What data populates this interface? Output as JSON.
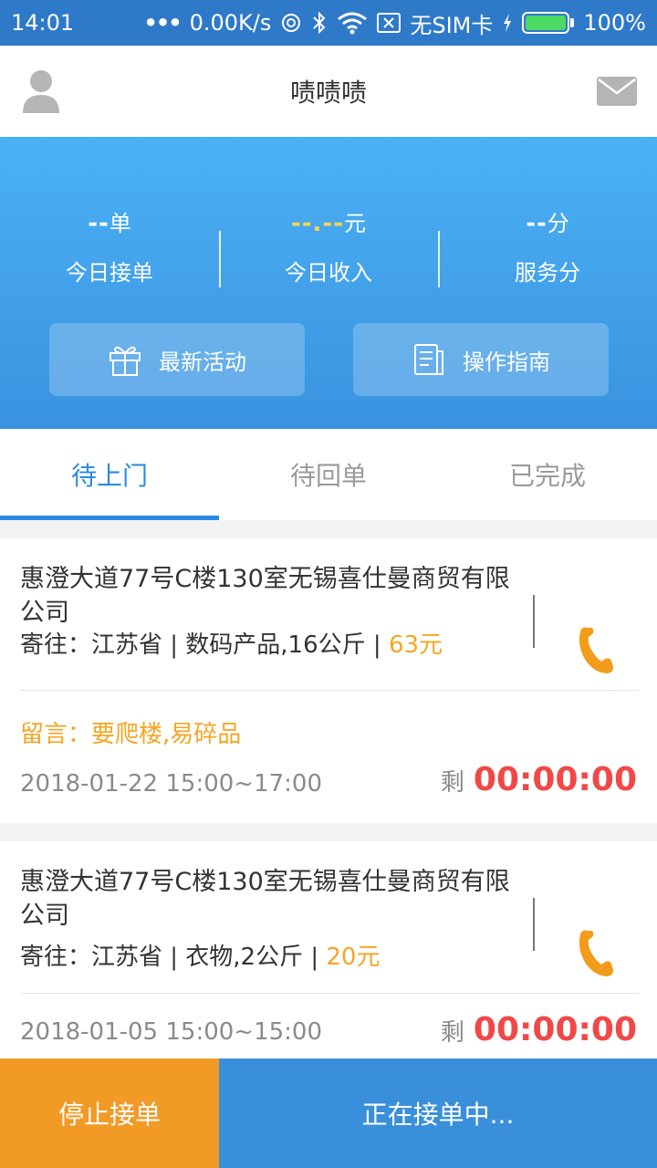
{
  "status_bar": {
    "time": "14:01",
    "network_speed": "0.00K/s",
    "sim": "无SIM卡",
    "battery": "100%",
    "icons": [
      "dots-icon",
      "sync-icon",
      "bluetooth-icon",
      "wifi-icon",
      "no-sim-icon",
      "charging-icon",
      "battery-icon"
    ]
  },
  "header": {
    "title": "啧啧啧",
    "icons": [
      "avatar-icon",
      "mail-icon"
    ]
  },
  "stats": [
    {
      "value": "--",
      "unit": "单",
      "label": "今日接单"
    },
    {
      "value": "--.--",
      "unit": "元",
      "label": "今日收入"
    },
    {
      "value": "--",
      "unit": "分",
      "label": "服务分"
    }
  ],
  "actions": {
    "activity_label": "最新活动",
    "guide_label": "操作指南"
  },
  "tabs": [
    {
      "label": "待上门",
      "active": true
    },
    {
      "label": "待回单",
      "active": false
    },
    {
      "label": "已完成",
      "active": false
    }
  ],
  "orders": [
    {
      "address": "惠澄大道77号C楼130室无锡喜仕曼商贸有限公司",
      "info_prefix": "寄往：江苏省 | 数码产品,16公斤 | ",
      "price": "63元",
      "note": "留言：要爬楼,易碎品",
      "date": "2018-01-22 15:00~17:00",
      "remain_label": "剩",
      "remain_time": "00:00:00"
    },
    {
      "address": "惠澄大道77号C楼130室无锡喜仕曼商贸有限公司",
      "info_prefix": "寄往：江苏省 | 衣物,2公斤 | ",
      "price": "20元",
      "date": "2018-01-05 15:00~15:00",
      "remain_label": "剩",
      "remain_time": "00:00:00"
    }
  ],
  "bottom": {
    "stop_label": "停止接单",
    "taking_label": "正在接单中..."
  },
  "colors": {
    "accent_blue": "#2a8ae2",
    "orange": "#f5a623",
    "red": "#f04848"
  }
}
